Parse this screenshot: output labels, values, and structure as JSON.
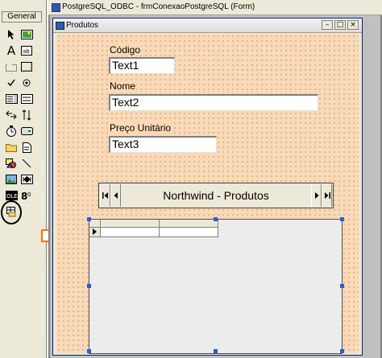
{
  "designer": {
    "title": "PostgreSQL_ODBC - frmConexaoPostgreSQL (Form)"
  },
  "toolbox": {
    "tab_label": "General"
  },
  "form": {
    "caption": "Produtos",
    "codigo": {
      "label": "Código",
      "value": "Text1"
    },
    "nome": {
      "label": "Nome",
      "value": "Text2"
    },
    "preco": {
      "label": "Preço Unitário",
      "value": "Text3"
    },
    "data_control": {
      "caption": "Northwind - Produtos"
    }
  }
}
